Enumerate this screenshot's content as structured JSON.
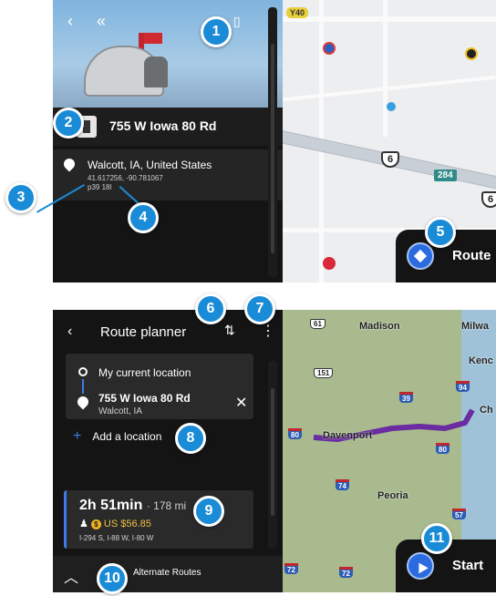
{
  "place": {
    "title": "755 W Iowa 80 Rd",
    "address": "Walcott, IA, United States",
    "coordinates": "41.617256, -90.781067",
    "code": "p39 18l",
    "route_label": "Route"
  },
  "map_top": {
    "shield_y40": "Y40",
    "shield_6a": "6",
    "shield_6b": "6",
    "shield_284": "284"
  },
  "planner": {
    "title": "Route planner",
    "from": "My current location",
    "to": "755 W Iowa 80 Rd",
    "to_sub": "Walcott, IA",
    "add_location": "Add a location",
    "time": "2h 51min",
    "distance": "· 178 mi",
    "toll": "US $56.85",
    "roads": "I-294 S, I-88 W, I-80 W",
    "alternate": "Alternate Routes",
    "start_label": "Start"
  },
  "map_bottom": {
    "cities": [
      "Madison",
      "Milwa",
      "Kenc",
      "Ch",
      "Davenport",
      "Peoria"
    ],
    "shields": [
      "61",
      "151",
      "39",
      "94",
      "80",
      "80",
      "74",
      "57",
      "72",
      "72"
    ]
  },
  "callouts": [
    "1",
    "2",
    "3",
    "4",
    "5",
    "6",
    "7",
    "8",
    "9",
    "10",
    "11"
  ],
  "colors": {
    "accent": "#1a8bd6",
    "route": "#6a2ca0",
    "panel": "#141414"
  }
}
